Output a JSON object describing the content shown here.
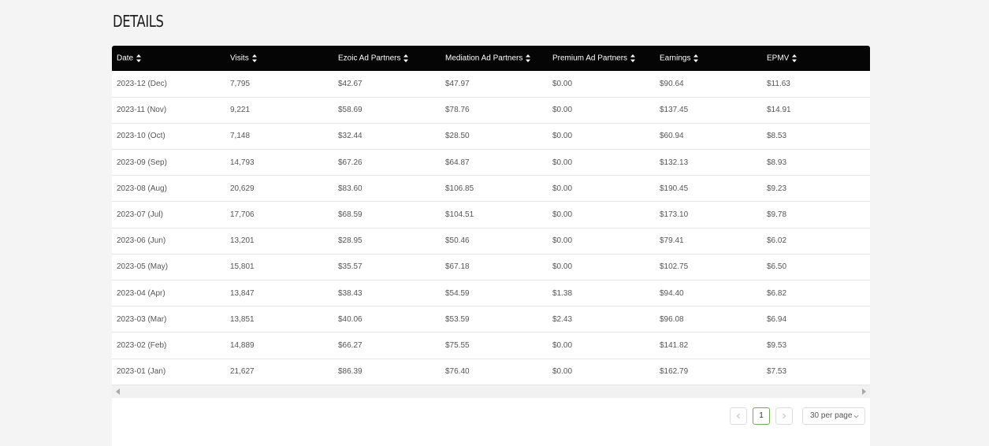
{
  "page": {
    "title": "DETAILS"
  },
  "table": {
    "columns": [
      "Date",
      "Visits",
      "Ezoic Ad Partners",
      "Mediation Ad Partners",
      "Premium Ad Partners",
      "Earnings",
      "EPMV"
    ],
    "rows": [
      [
        "2023-12 (Dec)",
        "7,795",
        "$42.67",
        "$47.97",
        "$0.00",
        "$90.64",
        "$11.63"
      ],
      [
        "2023-11 (Nov)",
        "9,221",
        "$58.69",
        "$78.76",
        "$0.00",
        "$137.45",
        "$14.91"
      ],
      [
        "2023-10 (Oct)",
        "7,148",
        "$32.44",
        "$28.50",
        "$0.00",
        "$60.94",
        "$8.53"
      ],
      [
        "2023-09 (Sep)",
        "14,793",
        "$67.26",
        "$64.87",
        "$0.00",
        "$132.13",
        "$8.93"
      ],
      [
        "2023-08 (Aug)",
        "20,629",
        "$83.60",
        "$106.85",
        "$0.00",
        "$190.45",
        "$9.23"
      ],
      [
        "2023-07 (Jul)",
        "17,706",
        "$68.59",
        "$104.51",
        "$0.00",
        "$173.10",
        "$9.78"
      ],
      [
        "2023-06 (Jun)",
        "13,201",
        "$28.95",
        "$50.46",
        "$0.00",
        "$79.41",
        "$6.02"
      ],
      [
        "2023-05 (May)",
        "15,801",
        "$35.57",
        "$67.18",
        "$0.00",
        "$102.75",
        "$6.50"
      ],
      [
        "2023-04 (Apr)",
        "13,847",
        "$38.43",
        "$54.59",
        "$1.38",
        "$94.40",
        "$6.82"
      ],
      [
        "2023-03 (Mar)",
        "13,851",
        "$40.06",
        "$53.59",
        "$2.43",
        "$96.08",
        "$6.94"
      ],
      [
        "2023-02 (Feb)",
        "14,889",
        "$66.27",
        "$75.55",
        "$0.00",
        "$141.82",
        "$9.53"
      ],
      [
        "2023-01 (Jan)",
        "21,627",
        "$86.39",
        "$76.40",
        "$0.00",
        "$162.79",
        "$7.53"
      ]
    ]
  },
  "pagination": {
    "prev_icon": "chevron-left-icon",
    "current_page": "1",
    "next_icon": "chevron-right-icon",
    "per_page": "30 per page",
    "current_page_border": "#6fae4a"
  },
  "colors": {
    "header_bg": "#050505",
    "header_text": "#ffffff",
    "page_bg": "#f4f4f5"
  }
}
